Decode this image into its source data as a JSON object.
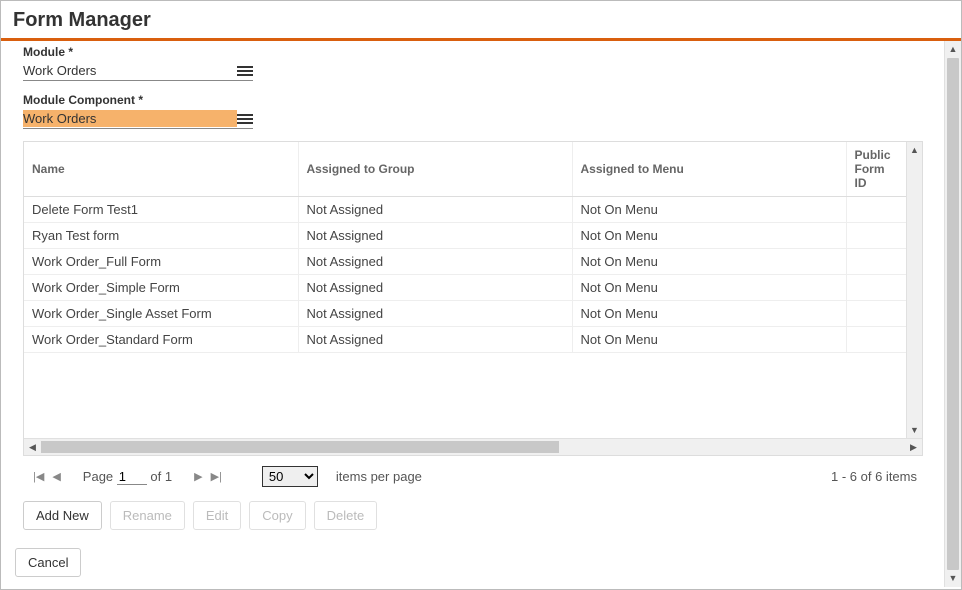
{
  "header": {
    "title": "Form Manager"
  },
  "fields": {
    "module": {
      "label": "Module *",
      "value": "Work Orders"
    },
    "component": {
      "label": "Module Component *",
      "value": "Work Orders"
    }
  },
  "table": {
    "columns": {
      "name": "Name",
      "group": "Assigned to Group",
      "menu": "Assigned to Menu",
      "id": "Public Form ID"
    },
    "rows": [
      {
        "name": "Delete Form Test1",
        "group": "Not Assigned",
        "menu": "Not On Menu",
        "id": ""
      },
      {
        "name": "Ryan Test form",
        "group": "Not Assigned",
        "menu": "Not On Menu",
        "id": ""
      },
      {
        "name": "Work Order_Full Form",
        "group": "Not Assigned",
        "menu": "Not On Menu",
        "id": ""
      },
      {
        "name": "Work Order_Simple Form",
        "group": "Not Assigned",
        "menu": "Not On Menu",
        "id": ""
      },
      {
        "name": "Work Order_Single Asset Form",
        "group": "Not Assigned",
        "menu": "Not On Menu",
        "id": ""
      },
      {
        "name": "Work Order_Standard Form",
        "group": "Not Assigned",
        "menu": "Not On Menu",
        "id": ""
      }
    ]
  },
  "pager": {
    "page_label": "Page",
    "page": "1",
    "of_label": "of 1",
    "page_size": "50",
    "per_page_label": "items per page",
    "summary": "1 - 6 of 6 items"
  },
  "buttons": {
    "add": "Add New",
    "rename": "Rename",
    "edit": "Edit",
    "copy": "Copy",
    "delete": "Delete",
    "cancel": "Cancel"
  }
}
